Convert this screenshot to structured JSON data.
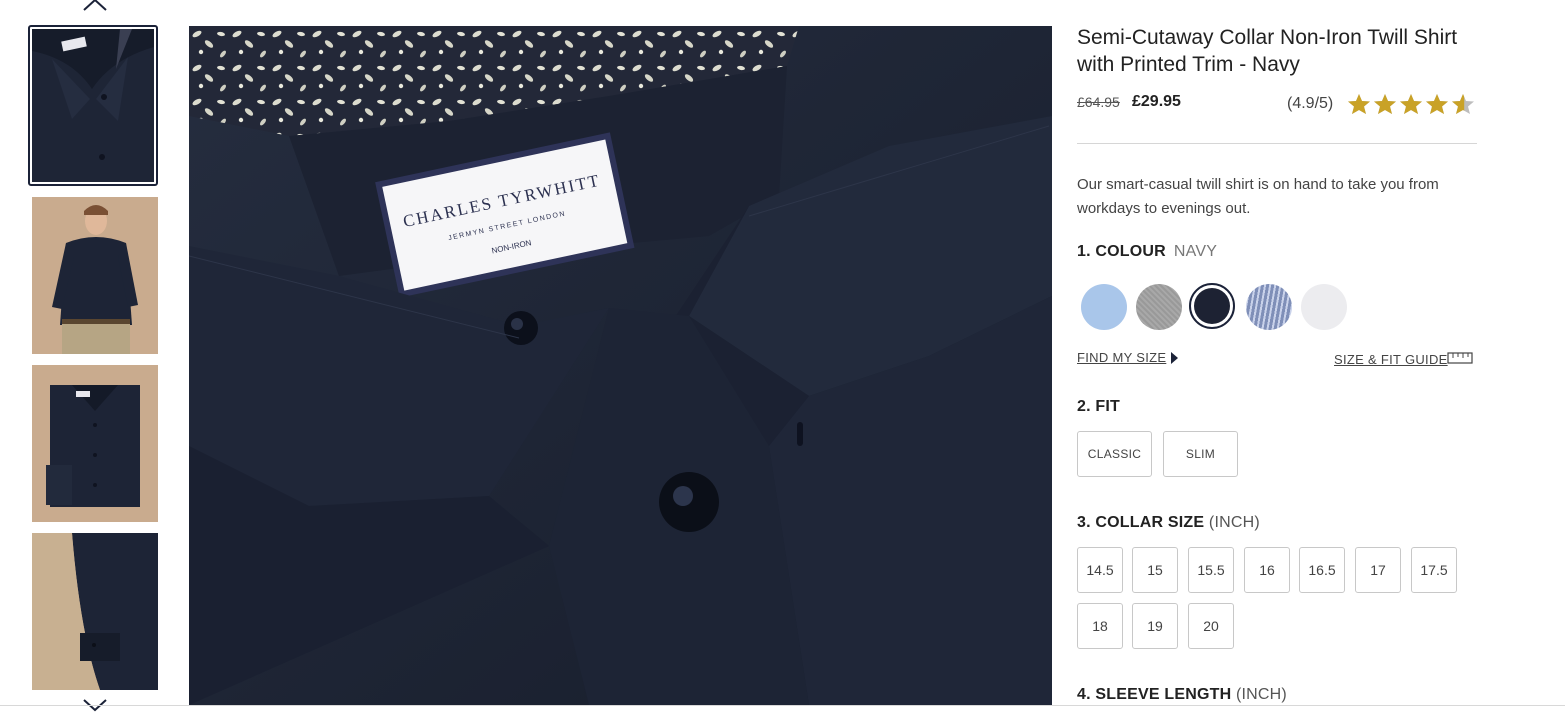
{
  "gallery": {
    "thumbnails": [
      {
        "name": "thumb-shirt-detail",
        "active": true
      },
      {
        "name": "thumb-model",
        "active": false
      },
      {
        "name": "thumb-folded",
        "active": false
      },
      {
        "name": "thumb-sleeve",
        "active": false
      }
    ],
    "up_icon": "chevron-up-icon",
    "down_icon": "chevron-down-icon"
  },
  "main_image": {
    "label_lines": [
      "CHARLES TYRWHITT",
      "JERMYN STREET LONDON",
      "NON-IRON"
    ]
  },
  "product": {
    "title": "Semi-Cutaway Collar Non-Iron Twill Shirt with Printed Trim - Navy",
    "old_price": "£64.95",
    "price": "£29.95",
    "rating_text": "(4.9/5)",
    "rating": 4.9,
    "rating_max": 5,
    "star_color": "#c9a227",
    "description": "Our smart-casual twill shirt is on hand to take you from workdays to evenings out."
  },
  "colour": {
    "label": "1. COLOUR",
    "selected": "NAVY",
    "swatches": [
      {
        "name": "light-blue",
        "hex": "#a9c6ea"
      },
      {
        "name": "grey",
        "hex": "#9c9c9c"
      },
      {
        "name": "navy",
        "hex": "#1d2233",
        "selected": true
      },
      {
        "name": "blue-stripe",
        "hex": "#7f8fb8"
      },
      {
        "name": "white",
        "hex": "#ececef"
      }
    ],
    "find_my_size": "FIND MY SIZE",
    "size_guide": "SIZE & FIT GUIDE"
  },
  "fit": {
    "label": "2. FIT",
    "options": [
      "CLASSIC",
      "SLIM"
    ]
  },
  "collar": {
    "label": "3. COLLAR SIZE",
    "unit": "(INCH)",
    "sizes": [
      "14.5",
      "15",
      "15.5",
      "16",
      "16.5",
      "17",
      "17.5",
      "18",
      "19",
      "20"
    ]
  },
  "sleeve": {
    "label": "4. SLEEVE LENGTH",
    "unit": "(INCH)"
  },
  "colors": {
    "accent": "#1b2238"
  }
}
